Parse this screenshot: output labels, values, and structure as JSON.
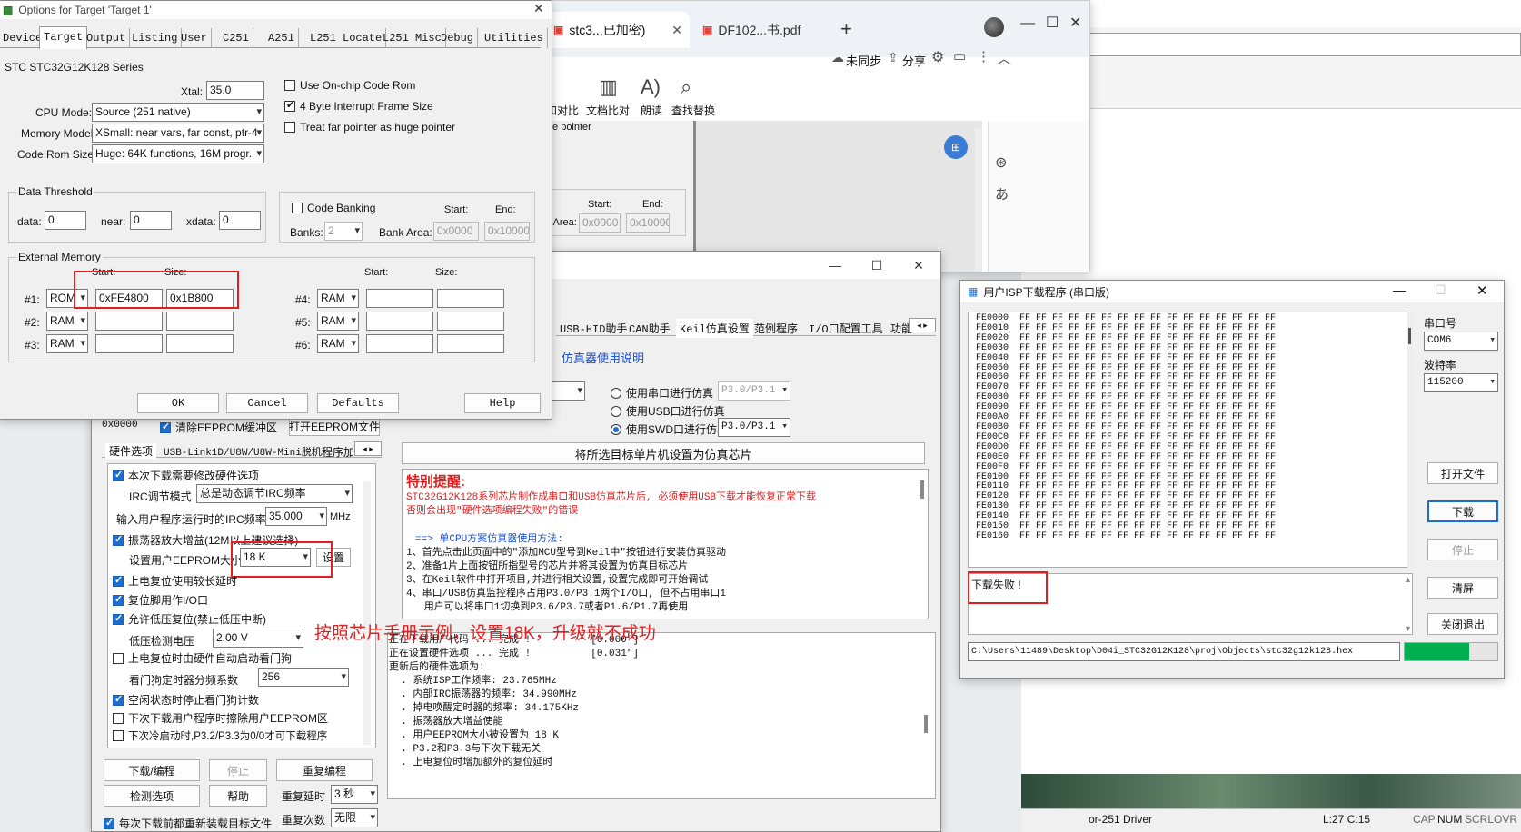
{
  "keil": {
    "title": "Options for Target 'Target 1'",
    "tabs": [
      "Device",
      "Target",
      "Output",
      "Listing",
      "User",
      "C251",
      "A251",
      "L251 Locate",
      "L251 Misc",
      "Debug",
      "Utilities"
    ],
    "device": "STC STC32G12K128 Series",
    "xtal_label": "Xtal:",
    "xtal": "35.0",
    "cpu_mode_label": "CPU Mode:",
    "cpu_mode": "Source (251 native)",
    "memory_model_label": "Memory Model:",
    "memory_model": "XSmall: near vars, far const, ptr-4",
    "code_rom_label": "Code Rom Size:",
    "code_rom": "Huge: 64K functions, 16M progr.",
    "opt_onchip": "Use On-chip Code Rom",
    "opt_4byte": "4 Byte Interrupt Frame Size",
    "opt_far": "Treat far pointer as huge pointer",
    "dt_title": "Data Threshold",
    "dt_data_label": "data:",
    "dt_data": "0",
    "dt_near_label": "near:",
    "dt_near": "0",
    "dt_xdata_label": "xdata:",
    "dt_xdata": "0",
    "cb_title": "Code Banking",
    "start_label": "Start:",
    "end_label": "End:",
    "banks_label": "Banks:",
    "banks": "2",
    "bank_area_label": "Bank Area:",
    "bank_start": "0x0000",
    "bank_end": "0x10000",
    "ext_title": "External Memory",
    "size_label": "Size:",
    "rows_left": [
      {
        "n": "#1:",
        "type": "ROM",
        "start": "0xFE4800",
        "size": "0x1B800"
      },
      {
        "n": "#2:",
        "type": "RAM",
        "start": "",
        "size": ""
      },
      {
        "n": "#3:",
        "type": "RAM",
        "start": "",
        "size": ""
      }
    ],
    "rows_right": [
      {
        "n": "#4:",
        "type": "RAM"
      },
      {
        "n": "#5:",
        "type": "RAM"
      },
      {
        "n": "#6:",
        "type": "RAM"
      }
    ],
    "ok": "OK",
    "cancel": "Cancel",
    "defaults": "Defaults",
    "help": "Help"
  },
  "browser": {
    "tab1": "stc3...已加密)",
    "tab2": "DF102...书.pdf",
    "sync": "未同步",
    "share": "分享",
    "tools": [
      "截图和对比",
      "文档比对",
      "朗读",
      "查找替换"
    ],
    "frag_text": "as huge pointer",
    "frag_start": "Start:",
    "frag_end": "End:",
    "frag_bank_area": "Bank Area:",
    "frag_bank_start": "0x0000",
    "frag_bank_end": "0x10000"
  },
  "stcisp": {
    "eeprom_addr": "0x0000",
    "clear_eeprom": "清除EEPROM缓冲区",
    "open_eeprom": "打开EEPROM文件",
    "tabs": [
      "硬件选项",
      "USB-Link1D/U8W/U8W-Mini脱机",
      "程序加"
    ],
    "opt_modify": "本次下载需要修改硬件选项",
    "irc_mode_label": "IRC调节模式",
    "irc_mode": "总是动态调节IRC频率",
    "irc_freq_label": "输入用户程序运行时的IRC频率",
    "irc_freq": "35.000",
    "irc_unit": "MHz",
    "osc_gain": "振荡器放大增益(12M以上建议选择)",
    "eeprom_size_label": "设置用户EEPROM大小",
    "eeprom_size": "18  K",
    "set_btn": "设置",
    "long_delay": "上电复位使用较长延时",
    "reset_io": "复位脚用作I/O口",
    "lvd_reset": "允许低压复位(禁止低压中断)",
    "lvd_label": "低压检测电压",
    "lvd_value": "2.00 V",
    "wdt_hw": "上电复位时由硬件自动启动看门狗",
    "wdt_div_label": "看门狗定时器分频系数",
    "wdt_div": "256",
    "idle_wdt": "空闲状态时停止看门狗计数",
    "erase_eeprom": "下次下载用户程序时擦除用户EEPROM区",
    "cold_boot": "下次冷启动时,P3.2/P3.3为0/0才可下载程序",
    "download": "下载/编程",
    "stop": "停止",
    "reprogram": "重复编程",
    "check": "检测选项",
    "help": "帮助",
    "retry_delay_label": "重复延时",
    "retry_delay": "3 秒",
    "retry_count_label": "重复次数",
    "retry_count": "无限",
    "reload": "每次下载前都重新装载目标文件",
    "annotation": "按照芯片手册示例，设置18K，升级就不成功",
    "right_tabs": [
      "USB-HID助手",
      "CAN助手",
      "Keil仿真设置",
      "范例程序",
      "I/O口配置工具",
      "功能"
    ],
    "emu_link": "仿真器使用说明",
    "emu_serial": "使用串口进行仿真",
    "emu_serial_port": "P3.0/P3.1",
    "emu_usb": "使用USB口进行仿真",
    "emu_swd": "使用SWD口进行仿真",
    "emu_swd_port": "P3.0/P3.1",
    "set_emu_btn": "将所选目标单片机设置为仿真芯片",
    "notice_title": "特别提醒:",
    "notice_lines": [
      "STC32G12K128系列芯片制作成串口和USB仿真芯片后, 必须使用USB下载才能恢复正常下载",
      "否则会出现\"硬件选项编程失败\"的错误"
    ],
    "howto_title": "==> 单CPU方案仿真器使用方法:",
    "howto_lines": [
      "1、首先点击此页面中的\"添加MCU型号到Keil中\"按钮进行安装仿真驱动",
      "2、准备1片上面按钮所指型号的芯片并将其设置为仿真目标芯片",
      "3、在Keil软件中打开项目,并进行相关设置,设置完成即可开始调试",
      "4、串口/USB仿真监控程序占用P3.0/P3.1两个I/O口, 但不占用串口1",
      "   用户可以将串口1切换到P3.6/P3.7或者P1.6/P1.7再使用"
    ],
    "log_lines": [
      "正在下载用户代码 ... 完成 !          [0.000\"]",
      "正在设置硬件选项 ... 完成 !          [0.031\"]",
      "",
      "更新后的硬件选项为:",
      "  . 系统ISP工作频率: 23.765MHz",
      "  . 内部IRC振荡器的频率: 34.990MHz",
      "  . 掉电唤醒定时器的频率: 34.175KHz",
      "  . 振荡器放大增益使能",
      "  . 用户EEPROM大小被设置为 18 K",
      "  . P3.2和P3.3与下次下载无关",
      "  . 上电复位时增加额外的复位延时"
    ]
  },
  "isp": {
    "title": "用户ISP下载程序 (串口版)",
    "hex_rows": [
      "FE0000  FF FF FF FF FF FF FF FF FF FF FF FF FF FF FF FF",
      "FE0010  FF FF FF FF FF FF FF FF FF FF FF FF FF FF FF FF",
      "FE0020  FF FF FF FF FF FF FF FF FF FF FF FF FF FF FF FF",
      "FE0030  FF FF FF FF FF FF FF FF FF FF FF FF FF FF FF FF",
      "FE0040  FF FF FF FF FF FF FF FF FF FF FF FF FF FF FF FF",
      "FE0050  FF FF FF FF FF FF FF FF FF FF FF FF FF FF FF FF",
      "FE0060  FF FF FF FF FF FF FF FF FF FF FF FF FF FF FF FF",
      "FE0070  FF FF FF FF FF FF FF FF FF FF FF FF FF FF FF FF",
      "FE0080  FF FF FF FF FF FF FF FF FF FF FF FF FF FF FF FF",
      "FE0090  FF FF FF FF FF FF FF FF FF FF FF FF FF FF FF FF",
      "FE00A0  FF FF FF FF FF FF FF FF FF FF FF FF FF FF FF FF",
      "FE00B0  FF FF FF FF FF FF FF FF FF FF FF FF FF FF FF FF",
      "FE00C0  FF FF FF FF FF FF FF FF FF FF FF FF FF FF FF FF",
      "FE00D0  FF FF FF FF FF FF FF FF FF FF FF FF FF FF FF FF",
      "FE00E0  FF FF FF FF FF FF FF FF FF FF FF FF FF FF FF FF",
      "FE00F0  FF FF FF FF FF FF FF FF FF FF FF FF FF FF FF FF",
      "FE0100  FF FF FF FF FF FF FF FF FF FF FF FF FF FF FF FF",
      "FE0110  FF FF FF FF FF FF FF FF FF FF FF FF FF FF FF FF",
      "FE0120  FF FF FF FF FF FF FF FF FF FF FF FF FF FF FF FF",
      "FE0130  FF FF FF FF FF FF FF FF FF FF FF FF FF FF FF FF",
      "FE0140  FF FF FF FF FF FF FF FF FF FF FF FF FF FF FF FF",
      "FE0150  FF FF FF FF FF FF FF FF FF FF FF FF FF FF FF FF",
      "FE0160  FF FF FF FF FF FF FF FF FF FF FF FF FF FF FF FF"
    ],
    "port_label": "串口号",
    "port": "COM6",
    "baud_label": "波特率",
    "baud": "115200",
    "open_file": "打开文件",
    "download": "下载",
    "stop": "停止",
    "clear": "清屏",
    "close": "关闭退出",
    "status": "下载失败 !",
    "path": "C:\\Users\\11489\\Desktop\\D04i_STC32G12K128\\proj\\Objects\\stc32g12k128.hex",
    "progress": 0.7
  },
  "statusbar": {
    "driver": "or-251 Driver",
    "pos": "L:27 C:15",
    "caps": "CAP",
    "num": "NUM",
    "scrl": "SCRL",
    "ovr": "OVR"
  },
  "colors": {
    "red": "#e02020",
    "blue": "#1b6fd0",
    "green": "#00b050"
  }
}
